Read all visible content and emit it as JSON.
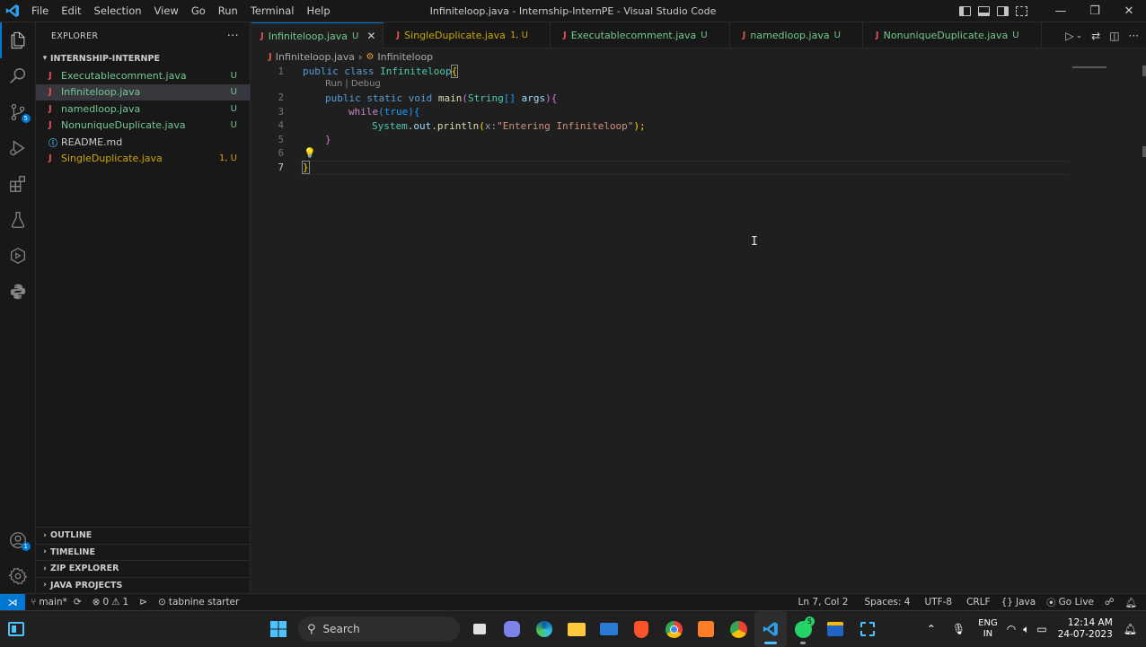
{
  "titlebar": {
    "menu": [
      "File",
      "Edit",
      "Selection",
      "View",
      "Go",
      "Run",
      "Terminal",
      "Help"
    ],
    "title": "Infiniteloop.java - Internship-InternPE - Visual Studio Code"
  },
  "activity": {
    "scm_badge": "5",
    "accounts_badge": "1"
  },
  "sidebar": {
    "header": "EXPLORER",
    "more": "···",
    "folder": "INTERNSHIP-INTERNPE",
    "files": [
      {
        "icon": "J",
        "name": "Executablecomment.java",
        "status": "U"
      },
      {
        "icon": "J",
        "name": "Infiniteloop.java",
        "status": "U"
      },
      {
        "icon": "J",
        "name": "namedloop.java",
        "status": "U"
      },
      {
        "icon": "J",
        "name": "NonuniqueDuplicate.java",
        "status": "U"
      },
      {
        "icon": "ⓘ",
        "name": "README.md",
        "status": ""
      },
      {
        "icon": "J",
        "name": "SingleDuplicate.java",
        "status": "1, U"
      }
    ],
    "sections": [
      "OUTLINE",
      "TIMELINE",
      "ZIP EXPLORER",
      "JAVA PROJECTS"
    ]
  },
  "tabs": [
    {
      "name": "Infiniteloop.java",
      "status": "U"
    },
    {
      "name": "SingleDuplicate.java",
      "status": "1, U"
    },
    {
      "name": "Executablecomment.java",
      "status": "U"
    },
    {
      "name": "namedloop.java",
      "status": "U"
    },
    {
      "name": "NonuniqueDuplicate.java",
      "status": "U"
    }
  ],
  "breadcrumb": {
    "file": "Infiniteloop.java",
    "symbol": "Infiniteloop"
  },
  "code": {
    "line_numbers": [
      "1",
      "2",
      "3",
      "4",
      "5",
      "6",
      "7"
    ],
    "codelens": "Run | Debug",
    "l1_kw": "public class ",
    "l1_cls": "Infiniteloop",
    "l1_br": "{",
    "l2_kw": "public static void ",
    "l2_fn": "main",
    "l2_p1": "(",
    "l2_type": "String",
    "l2_arr": "[] ",
    "l2_var": "args",
    "l2_p2": ")",
    "l2_br": "{",
    "l3_kw": "while",
    "l3_p": "(true)",
    "l3_br": "{",
    "l4_cls": "System",
    "l4_dot1": ".",
    "l4_var": "out",
    "l4_dot2": ".",
    "l4_fn": "println",
    "l4_p1": "(",
    "l4_hint": "x:",
    "l4_str": "\"Entering Infiniteloop\"",
    "l4_end": ");",
    "l5": "}",
    "l7": "}"
  },
  "status": {
    "branch": "main*",
    "errors": "0",
    "warnings": "1",
    "tabnine": "tabnine starter",
    "position": "Ln 7, Col 2",
    "spaces": "Spaces: 4",
    "encoding": "UTF-8",
    "eol": "CRLF",
    "language": "Java",
    "golive": "Go Live"
  },
  "taskbar": {
    "search": "Search",
    "whatsapp_badge": "5",
    "lang1": "ENG",
    "lang2": "IN",
    "time": "12:14 AM",
    "date": "24-07-2023"
  },
  "colors": {
    "accent": "#0078d4",
    "untracked": "#73c991",
    "warning": "#cca700"
  }
}
